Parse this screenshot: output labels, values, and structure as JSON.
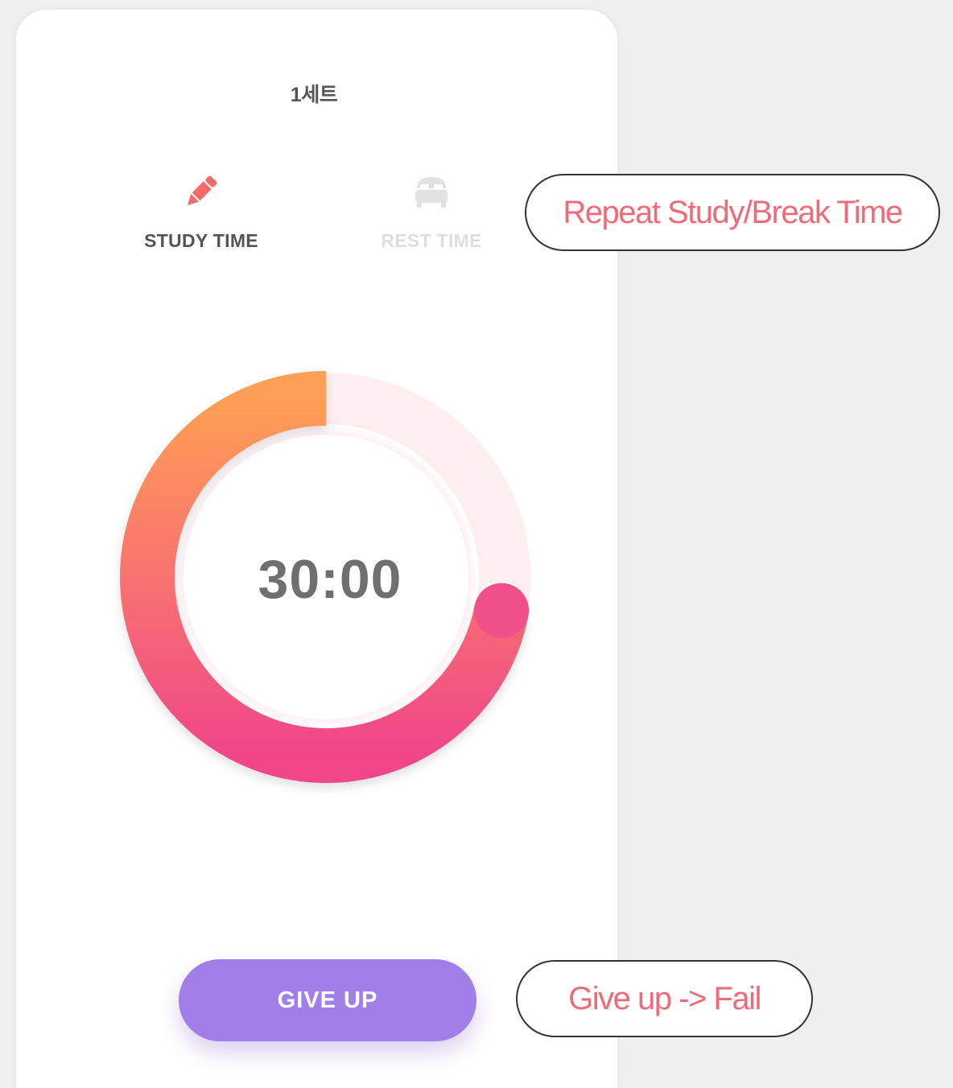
{
  "header": {
    "set_label": "1세트"
  },
  "modes": [
    {
      "label": "STUDY TIME",
      "icon": "pencil-icon",
      "active": true,
      "color": "#f46a6a"
    },
    {
      "label": "REST TIME",
      "icon": "bed-icon",
      "active": false,
      "color": "#e2e2e2"
    }
  ],
  "timer": {
    "display": "30:00",
    "progress": 0.72,
    "gradient_start": "#ff9f55",
    "gradient_end": "#f0468a",
    "track_color": "#fdeeef"
  },
  "actions": {
    "give_up_label": "GIVE UP",
    "give_up_color": "#a17ee8"
  },
  "annotations": {
    "repeat": "Repeat Study/Break Time",
    "give_up": "Give up -> Fail"
  }
}
